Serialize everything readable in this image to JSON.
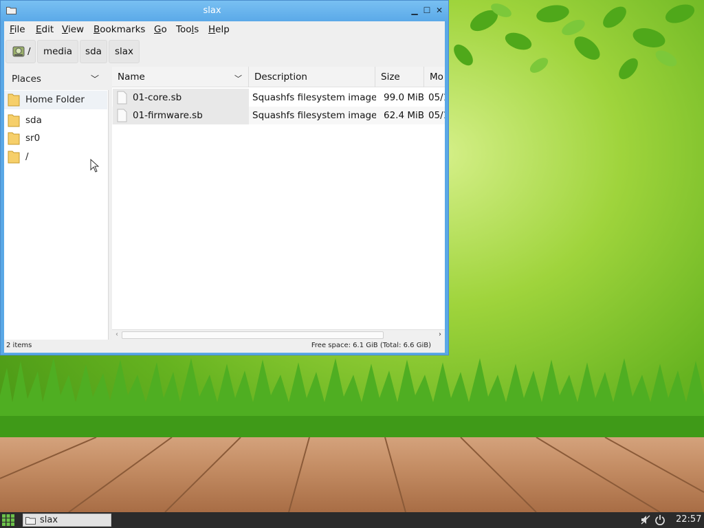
{
  "window": {
    "title": "slax"
  },
  "menubar": {
    "items": [
      {
        "label": "File",
        "accel": "F",
        "rest": "ile"
      },
      {
        "label": "Edit",
        "accel": "E",
        "rest": "dit"
      },
      {
        "label": "View",
        "accel": "V",
        "rest": "iew"
      },
      {
        "label": "Bookmarks",
        "accel": "B",
        "rest": "ookmarks"
      },
      {
        "label": "Go",
        "accel": "G",
        "rest": "o"
      },
      {
        "label": "Tools",
        "pre": "Too",
        "accel": "l",
        "rest": "s"
      },
      {
        "label": "Help",
        "accel": "H",
        "rest": "elp"
      }
    ]
  },
  "pathbar": {
    "segments": [
      "/",
      "media",
      "sda",
      "slax"
    ]
  },
  "sidebar": {
    "header": "Places",
    "items": [
      {
        "label": "Home Folder",
        "icon": "folder-icon"
      },
      {
        "label": "sda",
        "icon": "folder-icon"
      },
      {
        "label": "sr0",
        "icon": "folder-icon"
      },
      {
        "label": "/",
        "icon": "folder-icon"
      }
    ]
  },
  "filelist": {
    "columns": [
      "Name",
      "Description",
      "Size",
      "Mo"
    ],
    "rows": [
      {
        "name": "01-core.sb",
        "description": "Squashfs filesystem image",
        "size": "99.0 MiB",
        "modified": "05/1"
      },
      {
        "name": "01-firmware.sb",
        "description": "Squashfs filesystem image",
        "size": "62.4 MiB",
        "modified": "05/1"
      }
    ]
  },
  "statusbar": {
    "items": "2 items",
    "free_space": "Free space: 6.1 GiB (Total: 6.6 GiB)"
  },
  "taskbar": {
    "task_label": "slax",
    "clock": "22:57"
  },
  "colors": {
    "titlebar": "#5ba9e8",
    "taskbar": "#2b2b2b",
    "accent_green": "#66b320"
  }
}
